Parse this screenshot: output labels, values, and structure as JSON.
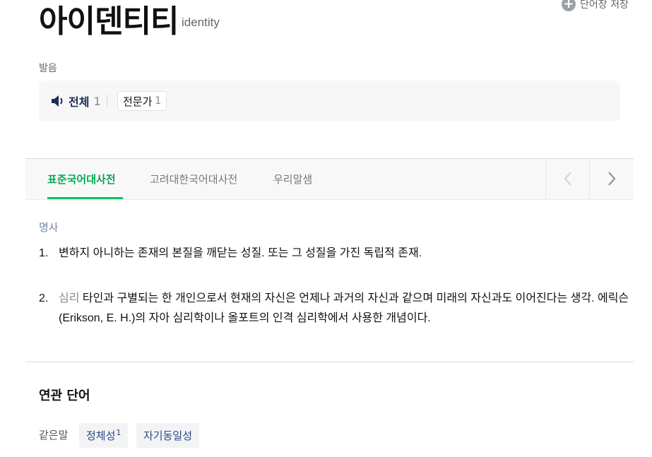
{
  "entry": {
    "headword": "아이덴티티",
    "original": "identity",
    "save_label": "단어장 저장"
  },
  "pronunciation": {
    "label": "발음",
    "all_label": "전체",
    "all_count": "1",
    "expert_label": "전문가",
    "expert_count": "1"
  },
  "tabs": [
    {
      "label": "표준국어대사전",
      "active": true
    },
    {
      "label": "고려대한국어대사전",
      "active": false
    },
    {
      "label": "우리말샘",
      "active": false
    }
  ],
  "definitions": {
    "pos": "명사",
    "items": [
      {
        "num": "1.",
        "field": "",
        "text": "변하지 아니하는 존재의 본질을 깨닫는 성질. 또는 그 성질을 가진 독립적 존재."
      },
      {
        "num": "2.",
        "field": "심리",
        "text": "타인과 구별되는 한 개인으로서 현재의 자신은 언제나 과거의 자신과 같으며 미래의 자신과도 이어진다는 생각. 에릭슨(Erikson, E. H.)의 자아 심리학이나 올포트의 인격 심리학에서 사용한 개념이다."
      }
    ]
  },
  "related": {
    "title": "연관 단어",
    "synonym_label": "같은말",
    "synonyms": [
      {
        "word": "정체성",
        "sup": "1"
      },
      {
        "word": "자기동일성",
        "sup": ""
      }
    ]
  },
  "colors": {
    "accent_green": "#03c75a",
    "link_blue": "#2b4a86",
    "pos_blue": "#7586a8"
  }
}
